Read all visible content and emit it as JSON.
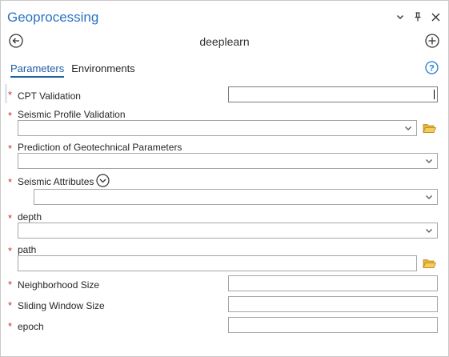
{
  "pane": {
    "title": "Geoprocessing",
    "icons": [
      "chevron-down-icon",
      "pin-icon",
      "close-icon"
    ]
  },
  "tool": {
    "name": "deeplearn"
  },
  "tabs": [
    {
      "label": "Parameters",
      "active": true
    },
    {
      "label": "Environments",
      "active": false
    }
  ],
  "params": {
    "cpt_validation": {
      "label": "CPT Validation",
      "required": true,
      "value": ""
    },
    "seismic_profile_validation": {
      "label": "Seismic Profile Validation",
      "required": true,
      "value": ""
    },
    "prediction_geotech": {
      "label": "Prediction of Geotechnical Parameters",
      "required": true,
      "value": ""
    },
    "seismic_attributes": {
      "label": "Seismic Attributes",
      "required": true,
      "value": ""
    },
    "depth": {
      "label": "depth",
      "required": true,
      "value": ""
    },
    "path": {
      "label": "path",
      "required": true,
      "value": ""
    },
    "neighborhood_size": {
      "label": "Neighborhood Size",
      "required": true,
      "value": ""
    },
    "sliding_window_size": {
      "label": "Sliding Window Size",
      "required": true,
      "value": ""
    },
    "epoch": {
      "label": "epoch",
      "required": true,
      "value": ""
    }
  },
  "colors": {
    "accent": "#1d5ea7",
    "title": "#2a73c5",
    "required": "#c0392b",
    "folder": "#e8b23c"
  }
}
